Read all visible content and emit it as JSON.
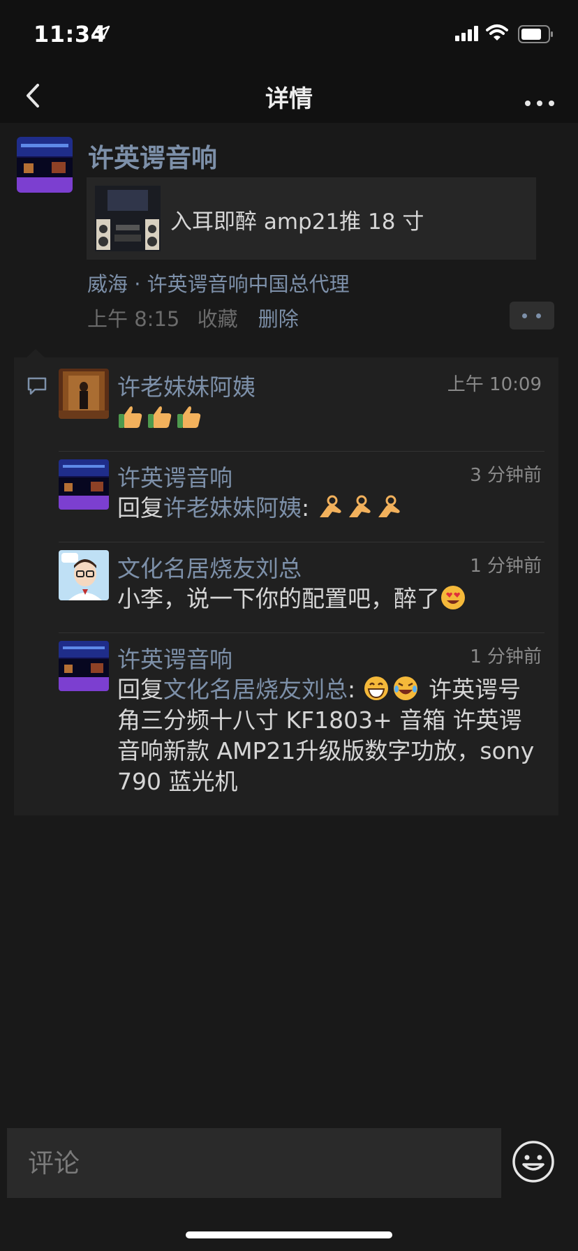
{
  "status_bar": {
    "time": "11:34"
  },
  "nav": {
    "title": "详情"
  },
  "post": {
    "author": "许英谔音响",
    "link_title": "入耳即醉 amp21推 18 寸",
    "location": "威海 · 许英谔音响中国总代理",
    "time": "上午 8:15",
    "favorite_label": "收藏",
    "delete_label": "删除"
  },
  "comments": [
    {
      "name": "许老妹妹阿姨",
      "time": "上午 10:09",
      "text": "",
      "emojis": [
        "thumbs-up",
        "thumbs-up",
        "thumbs-up"
      ]
    },
    {
      "name": "许英谔音响",
      "time": "3 分钟前",
      "reply_prefix": "回复",
      "reply_to": "许老妹妹阿姨",
      "text": ":",
      "emojis": [
        "ok-hand",
        "ok-hand",
        "ok-hand"
      ]
    },
    {
      "name": "文化名居烧友刘总",
      "time": "1 分钟前",
      "text": "小李，说一下你的配置吧，醉了",
      "emojis": [
        "heart-eyes"
      ]
    },
    {
      "name": "许英谔音响",
      "time": "1 分钟前",
      "reply_prefix": "回复",
      "reply_to": "文化名居烧友刘总",
      "text_after_emoji": "许英谔号角三分频十八寸 KF1803+ 音箱 许英谔音响新款 AMP21升级版数字功放，sony 790 蓝光机",
      "emojis": [
        "grinning",
        "laughing-tears"
      ]
    }
  ],
  "input": {
    "placeholder": "评论"
  },
  "colors": {
    "link": "#7d90a9",
    "background": "#191919",
    "panel": "#202020"
  }
}
